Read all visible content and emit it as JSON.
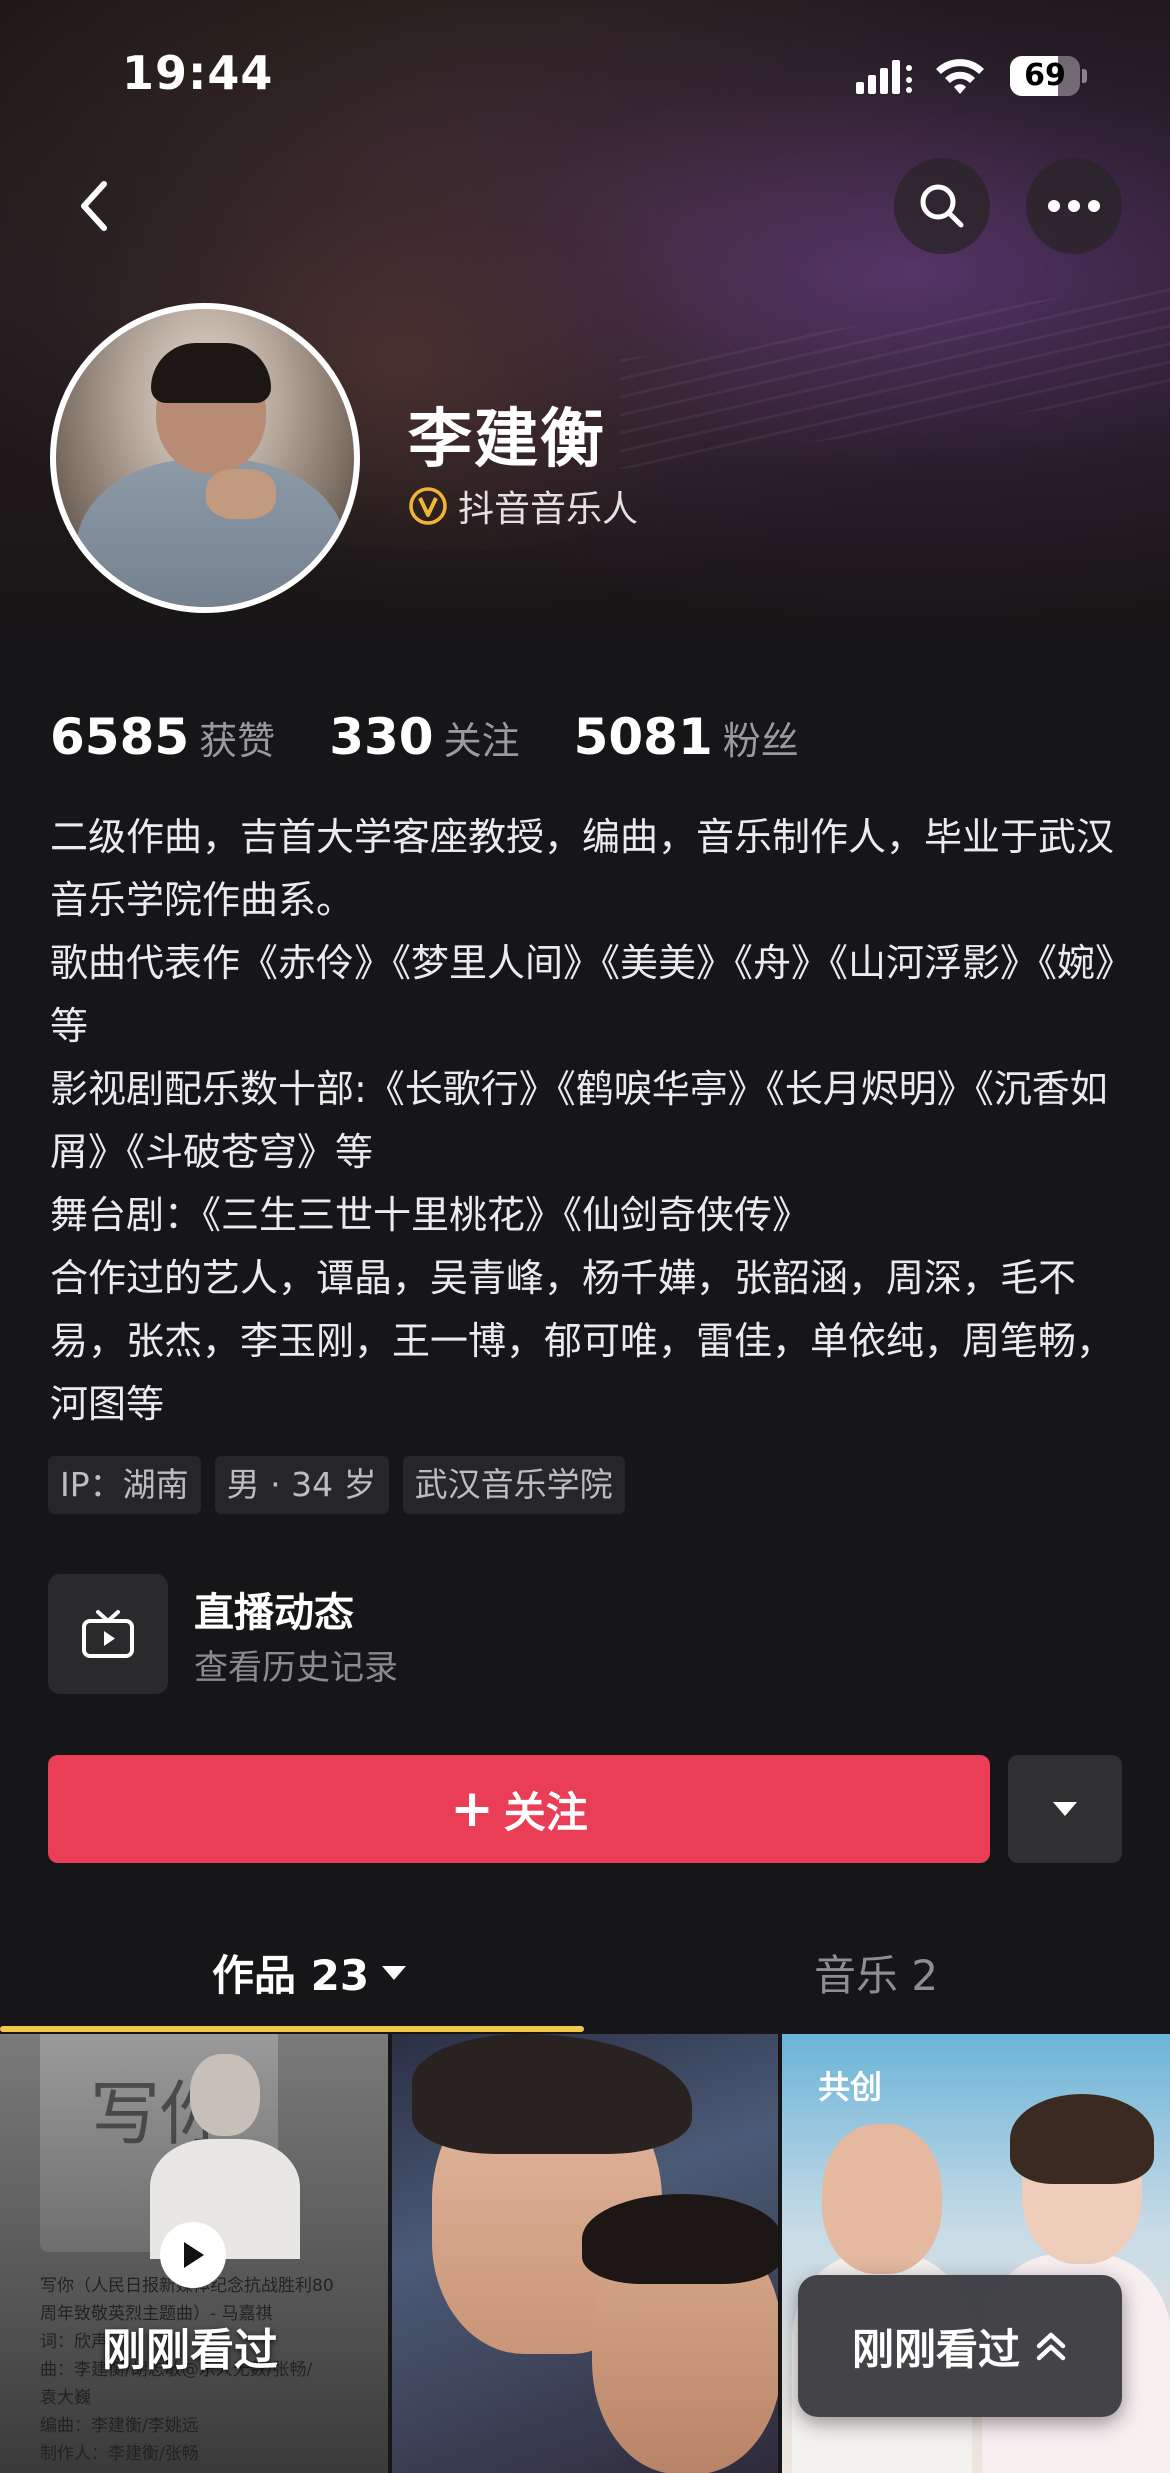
{
  "status_bar": {
    "time": "19:44",
    "battery_level": "69",
    "battery_fraction": 0.69,
    "icons": [
      "signal-icon",
      "wifi-icon",
      "battery-icon"
    ]
  },
  "header": {
    "icons": [
      "back-arrow-icon",
      "search-icon",
      "more-dots-icon"
    ]
  },
  "profile": {
    "name": "李建衡",
    "verified_label": "抖音音乐人",
    "verified_icon": "verified-v-icon",
    "accent_color": "#f2b532"
  },
  "stats": [
    {
      "value": "6585",
      "label": "获赞"
    },
    {
      "value": "330",
      "label": "关注"
    },
    {
      "value": "5081",
      "label": "粉丝"
    }
  ],
  "bio": [
    "二级作曲，吉首大学客座教授，编曲，音乐制作人，毕业于武汉音乐学院作曲系。",
    "歌曲代表作《赤伶》《梦里人间》《美美》《舟》《山河浮影》《婉》等",
    "影视剧配乐数十部:《长歌行》《鹤唳华亭》《长月烬明》《沉香如屑》《斗破苍穹》等",
    "舞台剧：《三生三世十里桃花》《仙剑奇侠传》",
    "合作过的艺人，谭晶，吴青峰，杨千嬅，张韶涵，周深，毛不易，张杰，李玉刚，王一博，郁可唯，雷佳，单依纯，周笔畅，河图等"
  ],
  "tags": [
    "IP：湖南",
    "男 · 34 岁",
    "武汉音乐学院"
  ],
  "live": {
    "title": "直播动态",
    "subtitle": "查看历史记录",
    "icon": "tv-icon"
  },
  "actions": {
    "follow_label": "关注",
    "follow_plus": "+",
    "follow_color": "#ea3e57",
    "dropdown_icon": "caret-down-icon"
  },
  "tabs": [
    {
      "label": "作品 23",
      "active": true
    },
    {
      "label": "音乐 2",
      "active": false
    }
  ],
  "grid": {
    "item1": {
      "calligraphy": "写你",
      "caption_lines": [
        "写你（人民日报新媒体纪念抗战胜利80",
        "周年致敬英烈主题曲）- 马嘉祺",
        "词：欣声",
        "曲：李建衡/胡志敏@乐人无数/张畅/",
        "袁大巍",
        "编曲：李建衡/李姚远",
        "制作人：李建衡/张畅"
      ],
      "overlay_label": "刚刚看过"
    },
    "item3": {
      "badge": "共创"
    }
  },
  "floating_pill": {
    "label": "刚刚看过",
    "icon": "double-chevron-up-icon"
  }
}
